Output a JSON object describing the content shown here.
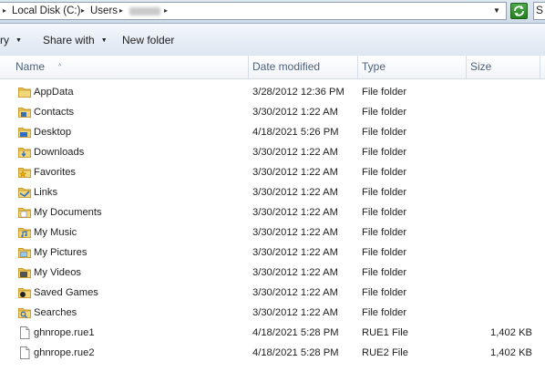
{
  "address": {
    "crumbs": [
      "Local Disk (C:)",
      "Users"
    ],
    "arrow": "▸",
    "dropdown_glyph": "▼",
    "search_placeholder": "S"
  },
  "toolbar": {
    "organize_label": "ry",
    "share_label": "Share with",
    "newfolder_label": "New folder",
    "caret": "▼"
  },
  "columns": {
    "name": "Name",
    "date": "Date modified",
    "type": "Type",
    "size": "Size",
    "sort_glyph": "^"
  },
  "rows": [
    {
      "name": "AppData",
      "date": "3/28/2012 12:36 PM",
      "type": "File folder",
      "size": "",
      "icon": "appdata-folder-icon"
    },
    {
      "name": "Contacts",
      "date": "3/30/2012 1:22 AM",
      "type": "File folder",
      "size": "",
      "icon": "contacts-folder-icon"
    },
    {
      "name": "Desktop",
      "date": "4/18/2021 5:26 PM",
      "type": "File folder",
      "size": "",
      "icon": "desktop-folder-icon"
    },
    {
      "name": "Downloads",
      "date": "3/30/2012 1:22 AM",
      "type": "File folder",
      "size": "",
      "icon": "downloads-folder-icon"
    },
    {
      "name": "Favorites",
      "date": "3/30/2012 1:22 AM",
      "type": "File folder",
      "size": "",
      "icon": "favorites-folder-icon"
    },
    {
      "name": "Links",
      "date": "3/30/2012 1:22 AM",
      "type": "File folder",
      "size": "",
      "icon": "links-folder-icon"
    },
    {
      "name": "My Documents",
      "date": "3/30/2012 1:22 AM",
      "type": "File folder",
      "size": "",
      "icon": "documents-folder-icon"
    },
    {
      "name": "My Music",
      "date": "3/30/2012 1:22 AM",
      "type": "File folder",
      "size": "",
      "icon": "music-folder-icon"
    },
    {
      "name": "My Pictures",
      "date": "3/30/2012 1:22 AM",
      "type": "File folder",
      "size": "",
      "icon": "pictures-folder-icon"
    },
    {
      "name": "My Videos",
      "date": "3/30/2012 1:22 AM",
      "type": "File folder",
      "size": "",
      "icon": "videos-folder-icon"
    },
    {
      "name": "Saved Games",
      "date": "3/30/2012 1:22 AM",
      "type": "File folder",
      "size": "",
      "icon": "saved-games-folder-icon"
    },
    {
      "name": "Searches",
      "date": "3/30/2012 1:22 AM",
      "type": "File folder",
      "size": "",
      "icon": "searches-folder-icon"
    },
    {
      "name": "ghnrope.rue1",
      "date": "4/18/2021 5:28 PM",
      "type": "RUE1 File",
      "size": "1,402 KB",
      "icon": "file-icon"
    },
    {
      "name": "ghnrope.rue2",
      "date": "4/18/2021 5:28 PM",
      "type": "RUE2 File",
      "size": "1,402 KB",
      "icon": "file-icon"
    }
  ],
  "colors": {
    "folder": "#e8c45a",
    "folder_dark": "#c99a26",
    "header_text": "#4c607a",
    "refresh": "#2e8f2b"
  }
}
